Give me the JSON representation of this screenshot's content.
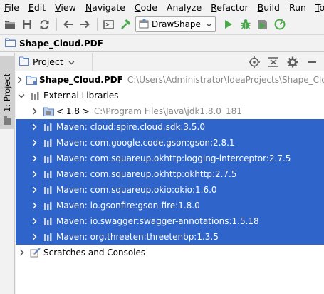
{
  "menu": [
    {
      "ul": "F",
      "rest": "ile"
    },
    {
      "ul": "E",
      "rest": "dit"
    },
    {
      "ul": "V",
      "rest": "iew"
    },
    {
      "ul": "N",
      "rest": "avigate"
    },
    {
      "ul": "C",
      "rest": "ode"
    },
    {
      "ul": "",
      "rest": "Analyze"
    },
    {
      "ul": "R",
      "rest": "efactor"
    },
    {
      "ul": "B",
      "rest": "uild"
    },
    {
      "ul": "",
      "rest": "Run"
    },
    {
      "ul": "T",
      "rest": "ools"
    }
  ],
  "toolbar": {
    "run_config": "DrawShape",
    "icons": [
      "folder-open-icon",
      "save-icon",
      "sync-icon",
      "back-arrow-icon",
      "forward-arrow-icon",
      "terminal-icon",
      "hammer-icon",
      "run-config-icon",
      "run-icon",
      "debug-icon",
      "coverage-icon",
      "profile-icon"
    ]
  },
  "navbar": {
    "crumb": "Shape_Cloud.PDF"
  },
  "side": {
    "tab_num": "1",
    "tab_label": ": Project"
  },
  "panel": {
    "view_label": "Project"
  },
  "tree": {
    "project_name": "Shape_Cloud.PDF",
    "project_path": "C:\\Users\\Administrator\\IdeaProjects\\Shape_Clou",
    "external_libraries": "External Libraries",
    "jdk_label": "< 1.8 >",
    "jdk_path": "C:\\Program Files\\Java\\jdk1.8.0_181",
    "maven": [
      "Maven: cloud:spire.cloud.sdk:3.5.0",
      "Maven: com.google.code.gson:gson:2.8.1",
      "Maven: com.squareup.okhttp:logging-interceptor:2.7.5",
      "Maven: com.squareup.okhttp:okhttp:2.7.5",
      "Maven: com.squareup.okio:okio:1.6.0",
      "Maven: io.gsonfire:gson-fire:1.8.0",
      "Maven: io.swagger:swagger-annotations:1.5.18",
      "Maven: org.threeten:threetenbp:1.3.5"
    ],
    "scratches": "Scratches and Consoles"
  },
  "colors": {
    "selection": "#2f65ca",
    "run_green": "#49a84a",
    "path_gray": "#888888"
  }
}
